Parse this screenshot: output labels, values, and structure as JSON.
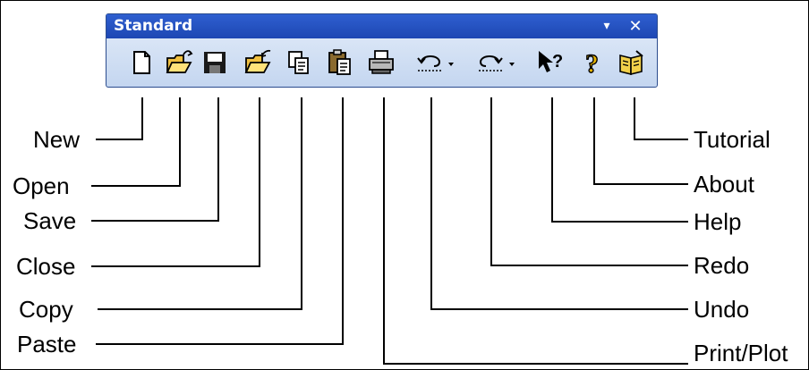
{
  "toolbar": {
    "title": "Standard",
    "menu_glyph": "▾",
    "close_glyph": "✕",
    "buttons": [
      {
        "id": "new",
        "icon": "new-document-icon"
      },
      {
        "id": "open",
        "icon": "open-folder-icon"
      },
      {
        "id": "save",
        "icon": "floppy-disk-icon"
      },
      {
        "id": "close",
        "icon": "close-folder-icon"
      },
      {
        "id": "copy",
        "icon": "copy-icon"
      },
      {
        "id": "paste",
        "icon": "paste-icon"
      },
      {
        "id": "print",
        "icon": "printer-icon"
      },
      {
        "id": "undo",
        "icon": "undo-arrow-icon"
      },
      {
        "id": "redo",
        "icon": "redo-arrow-icon"
      },
      {
        "id": "help",
        "icon": "whats-this-help-icon"
      },
      {
        "id": "about",
        "icon": "question-mark-icon"
      },
      {
        "id": "tutorial",
        "icon": "book-icon"
      }
    ]
  },
  "labels": {
    "new": "New",
    "open": "Open",
    "save": "Save",
    "close": "Close",
    "copy": "Copy",
    "paste": "Paste",
    "tutorial": "Tutorial",
    "about": "About",
    "help": "Help",
    "redo": "Redo",
    "undo": "Undo",
    "print": "Print/Plot"
  },
  "colors": {
    "title_bar": "#1d47b3",
    "toolbar_bg": "#c4d6f0",
    "leader_line": "#000000",
    "help_icon": "#d9a800"
  }
}
